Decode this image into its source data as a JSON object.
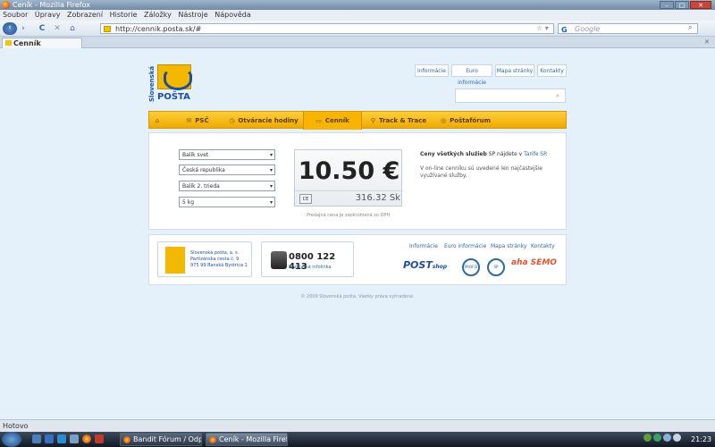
{
  "window": {
    "title": "Ceník - Mozilla Firefox",
    "min": "–",
    "max": "□",
    "close": "✕"
  },
  "menu": [
    "Soubor",
    "Úpravy",
    "Zobrazení",
    "Historie",
    "Záložky",
    "Nástroje",
    "Nápověda"
  ],
  "nav": {
    "url": "http://cennik.posta.sk/#",
    "search_placeholder": "Google",
    "reload": "C",
    "stop": "✕",
    "home": "⌂",
    "forward": "›",
    "back": "‹",
    "star": "☆ ▾",
    "search_go": "⌕",
    "search_engine": "G"
  },
  "tab": {
    "label": "Cenník",
    "close": "✕"
  },
  "site": {
    "logo_vertical": "Slovenská",
    "logo_text": "POŠTA",
    "top_links": [
      "Informácie",
      "Euro informácie",
      "Mapa stránky",
      "Kontakty"
    ],
    "search_icon": "⌕",
    "navigation": [
      {
        "icon": "⌂",
        "label": ""
      },
      {
        "icon": "✉",
        "label": "PSČ"
      },
      {
        "icon": "◷",
        "label": "Otváracie hodiny"
      },
      {
        "icon": "▭",
        "label": "Cenník"
      },
      {
        "icon": "⚲",
        "label": "Track & Trace"
      },
      {
        "icon": "◎",
        "label": "Poštafórum"
      }
    ],
    "selects": [
      "Balík svet",
      "Česká republika",
      "Balík 2. trieda",
      "5 kg"
    ],
    "select_arrow": "▾",
    "price": "10.50 €",
    "ce_button": "CE",
    "price_sk": "316.32 Sk",
    "price_note": "Predajná cena je zaokrúhlená so DPH",
    "info_bold": "Ceny všetkých služieb",
    "info_mid": " SP nájdete v ",
    "info_link": "Tarife SP",
    "info_end": ".",
    "info2": "V on-line cenníku sú uvedené len najčastejšie využívané služby.",
    "footer_address": [
      "Slovenská pošta, a. s.",
      "Partizánska cesta č. 9",
      "975 99 Banská Bystrica 1"
    ],
    "footer_phone": "0800 122 413",
    "footer_phone_sub": "bezplatná infolinka",
    "footer_links": [
      "Informácie",
      "Euro informácie",
      "Mapa stránky",
      "Kontakty"
    ],
    "postshop": "POST",
    "postshop_sub": "shop",
    "seal1": "PROFIS",
    "seal2": "SP",
    "aha": "aha SEMO",
    "copyright": "© 2009 Slovenská pošta. Všetky práva vyhradené."
  },
  "status": "Hotovo",
  "taskbar": {
    "tasks": [
      "Bandit Fórum / Odpo...",
      "Ceník - Mozilla Firef..."
    ],
    "clock": "21:23"
  }
}
